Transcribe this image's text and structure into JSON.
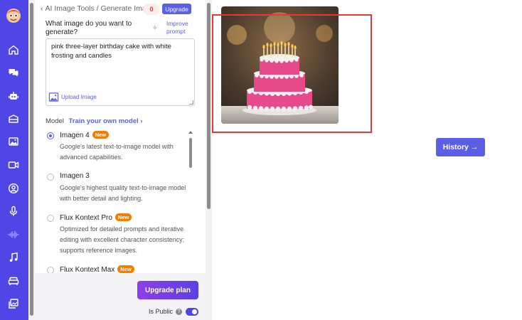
{
  "breadcrumb": {
    "back": "‹",
    "parent": "AI Image Tools",
    "separator": "/",
    "current": "Generate Imag"
  },
  "credits": {
    "count": "0"
  },
  "upgrade_top_label": "Upgrade",
  "prompt": {
    "question": "What image do you want to generate?",
    "improve_label": "Improve prompt",
    "value": "pink three-layer birthday cake with white frosting and candles",
    "upload_label": "Upload Image"
  },
  "model_section": {
    "label": "Model",
    "train_label": "Train your own model ›"
  },
  "models": [
    {
      "name": "Imagen 4",
      "badge": "New",
      "desc": "Google's latest text-to-image model with advanced capabilities.",
      "selected": true
    },
    {
      "name": "Imagen 3",
      "badge": "",
      "desc": "Google's highest quality text-to-image model with better detail and lighting.",
      "selected": false
    },
    {
      "name": "Flux Kontext Pro",
      "badge": "New",
      "desc": "Optimized for detailed prompts and iterative editing with excellent character consistency; supports reference images.",
      "selected": false
    },
    {
      "name": "Flux Kontext Max",
      "badge": "New",
      "desc": "",
      "selected": false
    }
  ],
  "footer": {
    "upgrade_plan_label": "Upgrade plan",
    "public_label": "Is Public",
    "public_on": true
  },
  "result": {
    "history_label": "History →"
  },
  "sidebar_icons": [
    "home-icon",
    "chat-icon",
    "robot-icon",
    "layers-icon",
    "image-icon",
    "video-icon",
    "user-icon",
    "mic-icon",
    "waveform-icon",
    "music-icon",
    "sofa-icon",
    "gallery-icon"
  ],
  "colors": {
    "primary": "#4f46e5",
    "accent": "#5b5fe3",
    "badge_orange": "#f57c00",
    "highlight_red": "#e53935"
  }
}
